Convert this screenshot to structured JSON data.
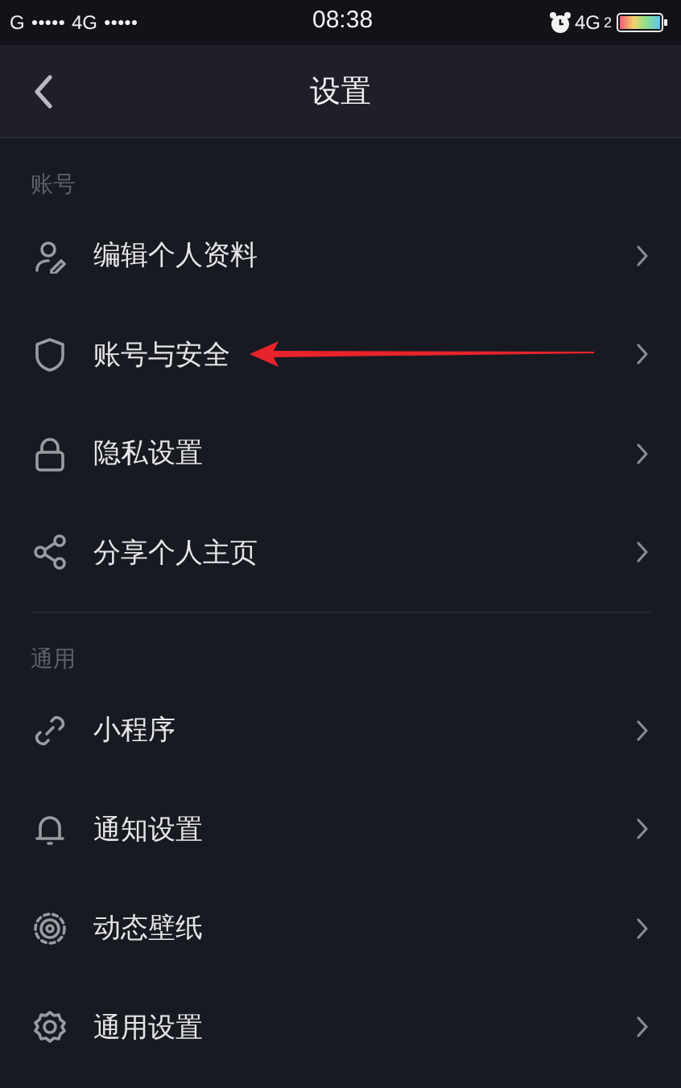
{
  "status_bar": {
    "carrier_1": "G",
    "signal_1": "●●●●●",
    "carrier_2": "4G",
    "signal_2": "●●●●●",
    "time": "08:38",
    "network": "4G",
    "network_sub": "2"
  },
  "header": {
    "title": "设置"
  },
  "sections": [
    {
      "label": "账号",
      "items": [
        {
          "label": "编辑个人资料",
          "highlighted": false
        },
        {
          "label": "账号与安全",
          "highlighted": true
        },
        {
          "label": "隐私设置",
          "highlighted": false
        },
        {
          "label": "分享个人主页",
          "highlighted": false
        }
      ]
    },
    {
      "label": "通用",
      "items": [
        {
          "label": "小程序",
          "highlighted": false
        },
        {
          "label": "通知设置",
          "highlighted": false
        },
        {
          "label": "动态壁纸",
          "highlighted": false
        },
        {
          "label": "通用设置",
          "highlighted": false
        }
      ]
    }
  ]
}
